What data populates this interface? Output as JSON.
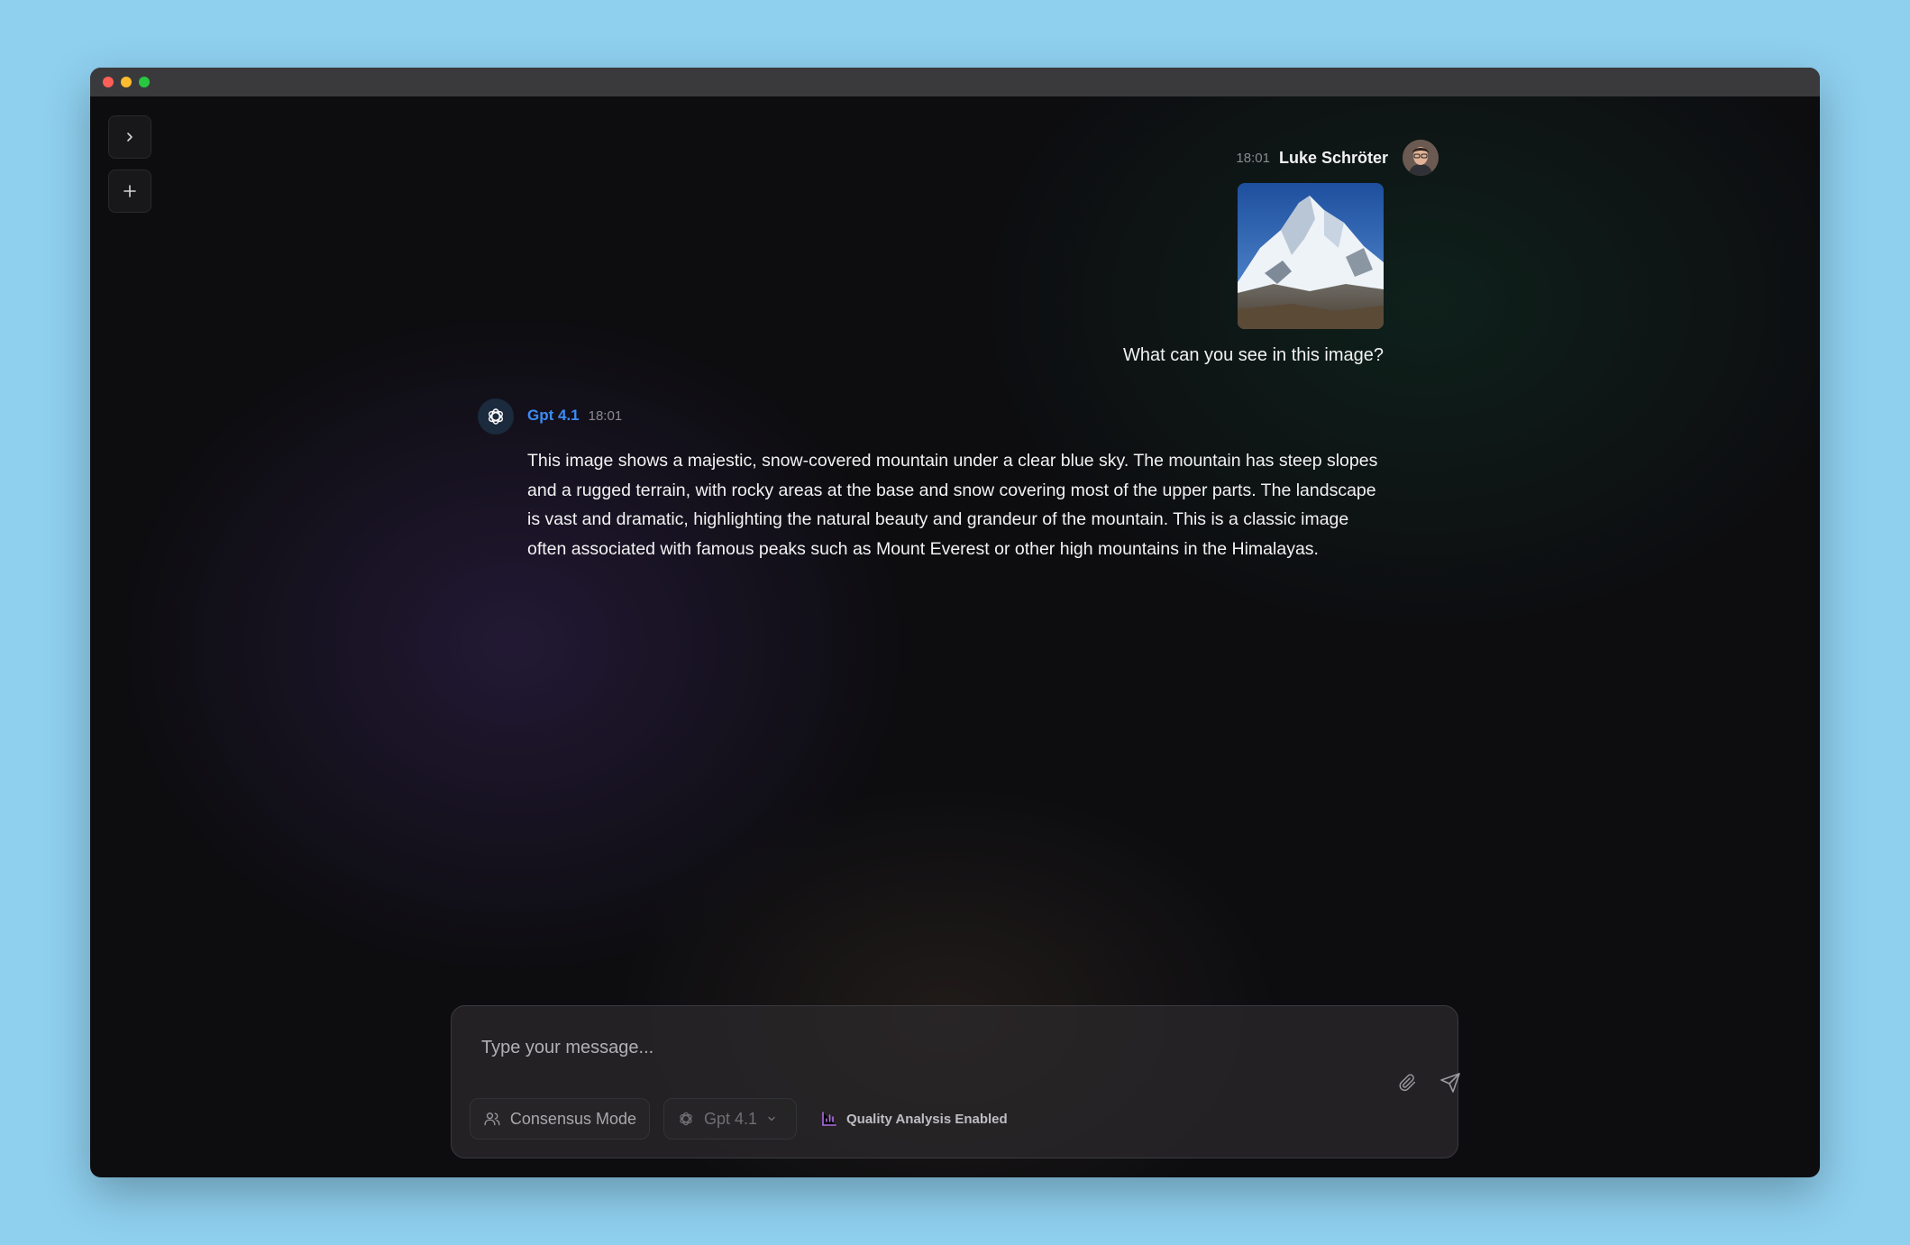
{
  "window": {
    "controls": [
      "close",
      "minimize",
      "maximize"
    ]
  },
  "sidebar": {
    "expand_icon": "chevron-right-icon",
    "new_chat_icon": "plus-icon"
  },
  "user_message": {
    "time": "18:01",
    "name": "Luke Schröter",
    "image_alt": "Snow-covered mountain photo",
    "text": "What can you see in this image?"
  },
  "assistant_message": {
    "model": "Gpt 4.1",
    "time": "18:01",
    "text": "This image shows a majestic, snow-covered mountain under a clear blue sky. The mountain has steep slopes and a rugged terrain, with rocky areas at the base and snow covering most of the upper parts. The landscape is vast and dramatic, highlighting the natural beauty and grandeur of the mountain. This is a classic image often associated with famous peaks such as Mount Everest or other high mountains in the Himalayas."
  },
  "composer": {
    "placeholder": "Type your message...",
    "consensus_label": "Consensus Mode",
    "model_label": "Gpt 4.1",
    "quality_label": "Quality Analysis Enabled"
  },
  "colors": {
    "accent_blue": "#3b8cf6",
    "quality_purple": "#b06ee8",
    "background_outer": "#8fd0ef",
    "window_bg": "#0d0d10"
  }
}
